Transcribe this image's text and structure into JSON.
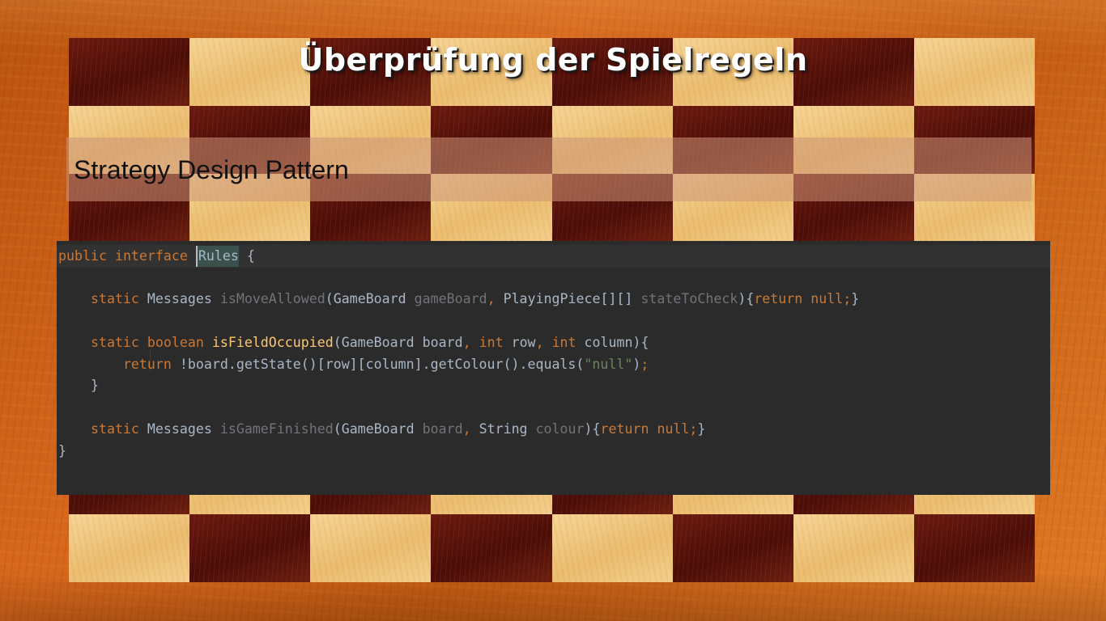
{
  "slide": {
    "title": "Überprüfung der Spielregeln",
    "subtitle": "Strategy Design Pattern"
  },
  "code": {
    "l1": {
      "kw1": "public",
      "kw2": "interface",
      "name": "Rules",
      "brace": "{"
    },
    "l2": {
      "kw_static": "static",
      "ret": "Messages",
      "method": "isMoveAllowed",
      "open": "(",
      "p1type": "GameBoard",
      "p1name": "gameBoard",
      "comma1": ",",
      "p2type": "PlayingPiece[][]",
      "p2name": "stateToCheck",
      "close": "){",
      "ret_kw": "return",
      "null": "null",
      "semi": ";",
      "end": "}"
    },
    "l3": {
      "kw_static": "static",
      "ret": "boolean",
      "method": "isFieldOccupied",
      "open": "(",
      "p1type": "GameBoard",
      "p1name": "board",
      "comma1": ",",
      "p2type": "int",
      "p2name": "row",
      "comma2": ",",
      "p3type": "int",
      "p3name": "column",
      "close": "){"
    },
    "l4": {
      "ret_kw": "return",
      "expr": "!board.getState()[row][column].getColour().equals(",
      "str": "\"null\"",
      "tail": ")",
      "semi": ";"
    },
    "l5": {
      "brace": "}"
    },
    "l6": {
      "kw_static": "static",
      "ret": "Messages",
      "method": "isGameFinished",
      "open": "(",
      "p1type": "GameBoard",
      "p1name": "board",
      "comma1": ",",
      "p2type": "String",
      "p2name": "colour",
      "close": "){",
      "ret_kw": "return",
      "null": "null",
      "semi": ";",
      "end": "}"
    },
    "l7": {
      "brace": "}"
    }
  },
  "colors": {
    "frame": "#c25a14",
    "square_light": "#efc47c",
    "square_dark": "#5a140c",
    "code_bg": "#2b2b2b",
    "keyword": "#cc7832",
    "method": "#ffc66d",
    "string": "#6a8759",
    "text": "#a9b7c6",
    "dim": "#72737a"
  }
}
